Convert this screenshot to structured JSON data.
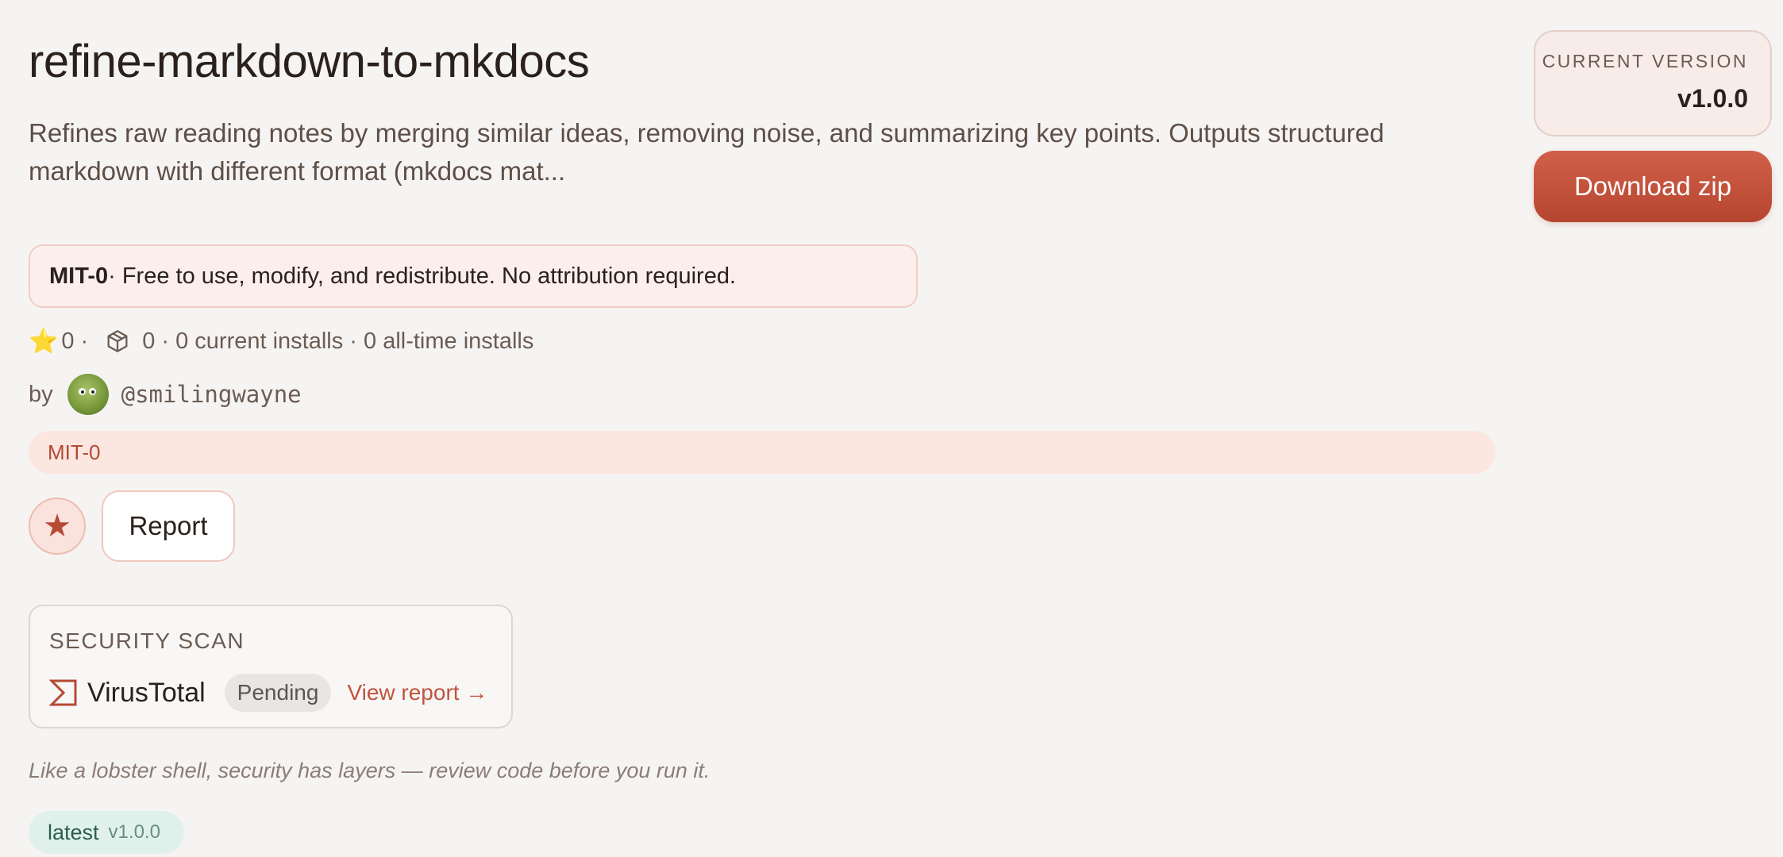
{
  "skill": {
    "title": "refine-markdown-to-mkdocs",
    "description": "Refines raw reading notes by merging similar ideas, removing noise, and summarizing key points. Outputs structured markdown with different format (mkdocs mat..."
  },
  "license_box": {
    "name": "MIT-0",
    "text": " · Free to use, modify, and redistribute. No attribution required."
  },
  "stats": {
    "stars": "0 ·",
    "summary": "0 · 0 current installs · 0 all-time installs",
    "star_icon": "star-icon",
    "package_icon": "package-icon"
  },
  "author": {
    "by_label": "by",
    "handle": "@smilingwayne"
  },
  "license_pill": "MIT-0",
  "actions": {
    "report_label": "Report"
  },
  "security_scan": {
    "title": "SECURITY SCAN",
    "scanner": "VirusTotal",
    "status": "Pending",
    "link": "View report →"
  },
  "tagline": "Like a lobster shell, security has layers — review code before you run it.",
  "tag": {
    "label": "latest",
    "version": "v1.0.0"
  },
  "sidebar": {
    "version_label": "CURRENT VERSION",
    "version_value": "v1.0.0",
    "download_label": "Download zip"
  },
  "colors": {
    "accent": "#c0543d",
    "background": "#f6f4f2",
    "license_bg": "#fcefeb",
    "latest_bg": "#e0f1ec"
  }
}
